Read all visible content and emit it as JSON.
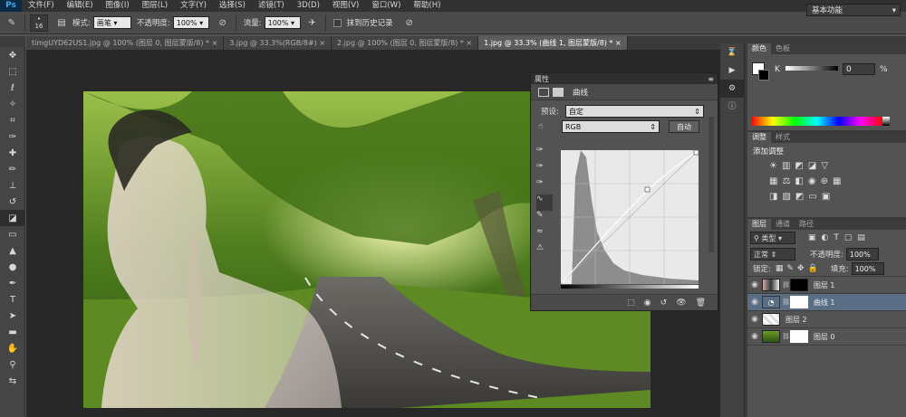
{
  "app": {
    "logo": "Ps",
    "menus": [
      "文件(F)",
      "编辑(E)",
      "图像(I)",
      "图层(L)",
      "文字(Y)",
      "选择(S)",
      "滤镜(T)",
      "3D(D)",
      "视图(V)",
      "窗口(W)",
      "帮助(H)"
    ]
  },
  "options": {
    "brush_size": "16",
    "mode_label": "模式:",
    "mode_value": "画笔",
    "opacity_label": "不透明度:",
    "opacity_value": "100%",
    "flow_label": "流量:",
    "flow_value": "100%",
    "erase_history_label": "抹到历史记录",
    "workspace": "基本功能"
  },
  "tabs": [
    {
      "label": "timgUYD62US1.jpg @ 100% (图层 0, 图层蒙版/8) *",
      "active": false
    },
    {
      "label": "3.jpg @ 33.3%(RGB/8#)",
      "active": false
    },
    {
      "label": "2.jpg @ 100% (图层 0, 图层蒙版/8) *",
      "active": false
    },
    {
      "label": "1.jpg @ 33.3% (曲线 1, 图层蒙版/8) *",
      "active": true
    }
  ],
  "properties": {
    "title": "属性",
    "subtitle": "曲线",
    "preset_label": "预设:",
    "preset_value": "自定",
    "channel_value": "RGB",
    "auto_button": "自动"
  },
  "color_panel": {
    "tab_color": "颜色",
    "tab_swatches": "色板",
    "k_label": "K",
    "k_value": "0",
    "k_unit": "%"
  },
  "adjust_panel": {
    "tab_adjust": "调整",
    "tab_styles": "样式",
    "add_label": "添加调整"
  },
  "layers_panel": {
    "tab_layers": "图层",
    "tab_channels": "通道",
    "tab_paths": "路径",
    "filter_kind": "类型",
    "blend_mode": "正常",
    "opacity_label": "不透明度:",
    "opacity_value": "100%",
    "lock_label": "锁定:",
    "fill_label": "填充:",
    "fill_value": "100%",
    "layers": [
      {
        "name": "图层 1",
        "selected": false
      },
      {
        "name": "曲线 1",
        "selected": true
      },
      {
        "name": "图层 2",
        "selected": false
      },
      {
        "name": "图层 0",
        "selected": false
      }
    ]
  },
  "colors": {
    "accent_selected": "#5a6f86",
    "bg_dark": "#282828",
    "panel": "#535353"
  }
}
